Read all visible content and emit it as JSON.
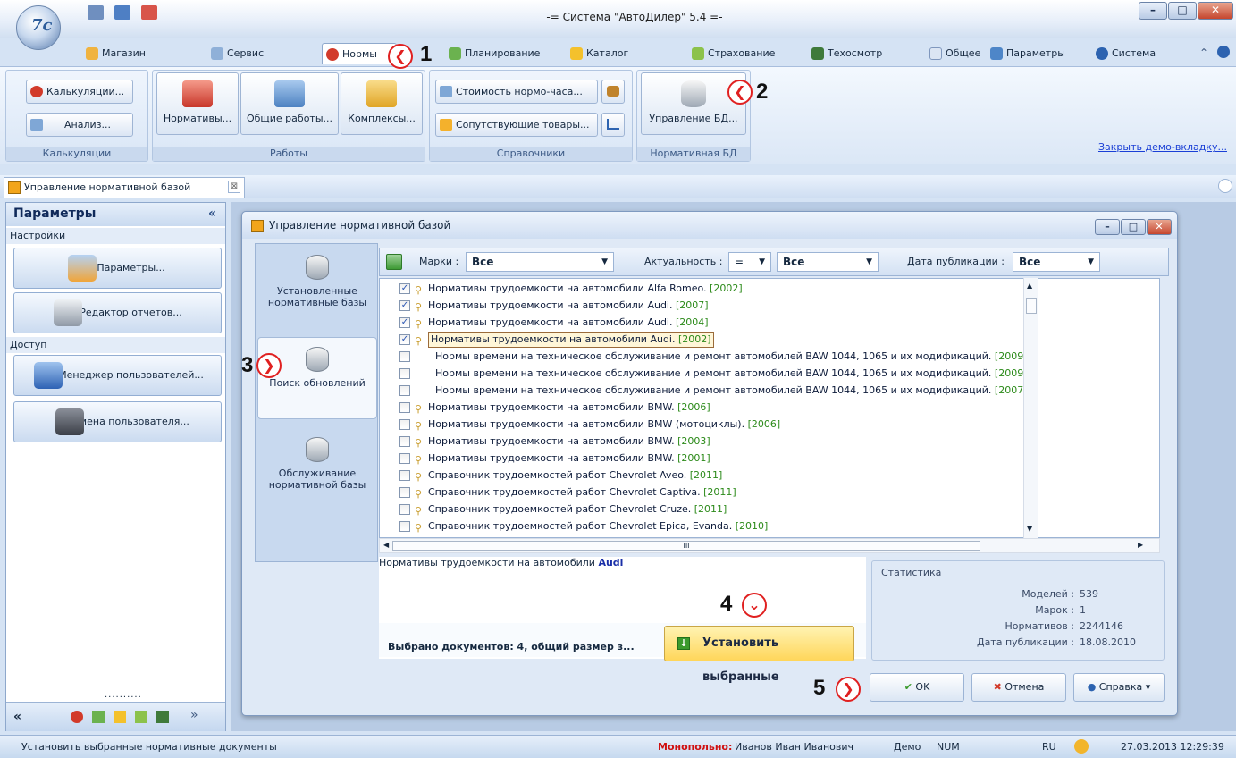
{
  "app_title": "-= Система \"АвтоДилер\" 5.4 =-",
  "window_buttons": {
    "minimize": "–",
    "maximize": "□",
    "close": "✕"
  },
  "ribbon_tabs": [
    {
      "label": "Магазин",
      "icon": "shop-icon"
    },
    {
      "label": "Сервис",
      "icon": "service-icon"
    },
    {
      "label": "Нормы",
      "icon": "norms-icon",
      "active": true
    },
    {
      "label": "Планирование",
      "icon": "planning-icon"
    },
    {
      "label": "Каталог",
      "icon": "catalog-icon"
    },
    {
      "label": "Страхование",
      "icon": "insurance-icon"
    },
    {
      "label": "Техосмотр",
      "icon": "inspection-icon"
    },
    {
      "label": "Общее",
      "icon": "common-icon"
    },
    {
      "label": "Параметры",
      "icon": "params-icon"
    },
    {
      "label": "Система",
      "icon": "help-icon"
    }
  ],
  "ribbon": {
    "groups": {
      "calc": "Калькуляции",
      "works": "Работы",
      "refs": "Справочники",
      "normdb": "Нормативная БД"
    },
    "calc_btn": "Калькуляции...",
    "analysis_btn": "Анализ...",
    "normatives_btn": "Нормативы...",
    "common_works_btn": "Общие работы...",
    "complexes_btn": "Комплексы...",
    "hour_cost_btn": "Стоимость нормо-часа...",
    "related_goods_btn": "Сопутствующие товары...",
    "db_mgmt_btn": "Управление БД...",
    "close_demo": "Закрыть демо-вкладку..."
  },
  "doc_tab": {
    "label": "Управление нормативной базой",
    "close": "⊠"
  },
  "sidebar": {
    "title": "Параметры",
    "collapse": "«",
    "section_settings": "Настройки",
    "params_btn": "Параметры...",
    "report_editor_btn": "Редактор отчетов...",
    "section_access": "Доступ",
    "user_manager_btn": "Менеджер пользователей...",
    "switch_user_btn": "Смена пользователя...",
    "dots": "..........",
    "bottom_left": "«",
    "bottom_more": "»"
  },
  "dialog": {
    "title": "Управление нормативной базой",
    "nav": {
      "installed": "Установленные нормативные базы",
      "search": "Поиск обновлений",
      "maintenance": "Обслуживание нормативной базы"
    },
    "filters": {
      "brands_label": "Марки :",
      "brands_value": "Все",
      "relevance_label": "Актуальность :",
      "relevance_op": "=",
      "relevance_value": "Все",
      "pubdate_label": "Дата публикации :",
      "pubdate_value": "Все"
    },
    "rows": [
      {
        "checked": true,
        "mag": true,
        "text": "Нормативы трудоемкости на автомобили Alfa Romeo.",
        "year": "[2002]"
      },
      {
        "checked": true,
        "mag": true,
        "text": "Нормативы трудоемкости на автомобили Audi.",
        "year": "[2007]"
      },
      {
        "checked": true,
        "mag": true,
        "text": "Нормативы трудоемкости на автомобили Audi.",
        "year": "[2004]"
      },
      {
        "checked": true,
        "mag": true,
        "text": "Нормативы трудоемкости на автомобили Audi.",
        "year": "[2002]",
        "selected": true
      },
      {
        "checked": false,
        "mag": false,
        "text": "Нормы времени на техническое обслуживание и ремонт автомобилей BAW 1044, 1065 и их модификаций.",
        "year": "[2009]"
      },
      {
        "checked": false,
        "mag": false,
        "text": "Нормы времени на техническое обслуживание и ремонт автомобилей BAW 1044, 1065 и их модификаций.",
        "year": "[2009]"
      },
      {
        "checked": false,
        "mag": false,
        "text": "Нормы времени на техническое обслуживание и ремонт автомобилей BAW 1044, 1065 и их модификаций.",
        "year": "[2007]"
      },
      {
        "checked": false,
        "mag": true,
        "text": "Нормативы трудоемкости на автомобили BMW.",
        "year": "[2006]"
      },
      {
        "checked": false,
        "mag": true,
        "text": "Нормативы трудоемкости на автомобили BMW (мотоциклы).",
        "year": "[2006]"
      },
      {
        "checked": false,
        "mag": true,
        "text": "Нормативы трудоемкости на автомобили BMW.",
        "year": "[2003]"
      },
      {
        "checked": false,
        "mag": true,
        "text": "Нормативы трудоемкости на автомобили BMW.",
        "year": "[2001]"
      },
      {
        "checked": false,
        "mag": true,
        "text": "Справочник трудоемкостей работ Chevrolet Aveo.",
        "year": "[2011]"
      },
      {
        "checked": false,
        "mag": true,
        "text": "Справочник трудоемкостей работ Chevrolet Captiva.",
        "year": "[2011]"
      },
      {
        "checked": false,
        "mag": true,
        "text": "Справочник трудоемкостей работ Chevrolet Cruze.",
        "year": "[2011]"
      },
      {
        "checked": false,
        "mag": true,
        "text": "Справочник трудоемкостей работ Chevrolet Epica, Evanda.",
        "year": "[2010]"
      }
    ],
    "scroll_mark": "III",
    "desc_prefix": "Нормативы трудоемкости на автомобили ",
    "desc_brand": "Audi",
    "stats": {
      "title": "Статистика",
      "models_label": "Моделей :",
      "models": "539",
      "brands_label": "Марок :",
      "brands": "1",
      "normatives_label": "Нормативов :",
      "normatives": "2244146",
      "pubdate_label": "Дата публикации :",
      "pubdate": "18.08.2010"
    },
    "selected_docs": "Выбрано документов: 4, общий размер з...",
    "install_btn": "Установить выбранные",
    "ok_btn": "OK",
    "cancel_btn": "Отмена",
    "help_btn": "Справка"
  },
  "annotations": [
    "1",
    "2",
    "3",
    "4",
    "5"
  ],
  "statusbar": {
    "hint": "Установить выбранные нормативные документы",
    "mono_label": "Монопольно:",
    "user": "Иванов Иван Иванович",
    "mode": "Демо",
    "num": "NUM",
    "lang": "RU",
    "datetime": "27.03.2013 12:29:39"
  },
  "colors": {
    "accent": "#1a3fd6",
    "year": "#2c8a1a",
    "mono": "#d01010",
    "annotation": "#e02020"
  }
}
